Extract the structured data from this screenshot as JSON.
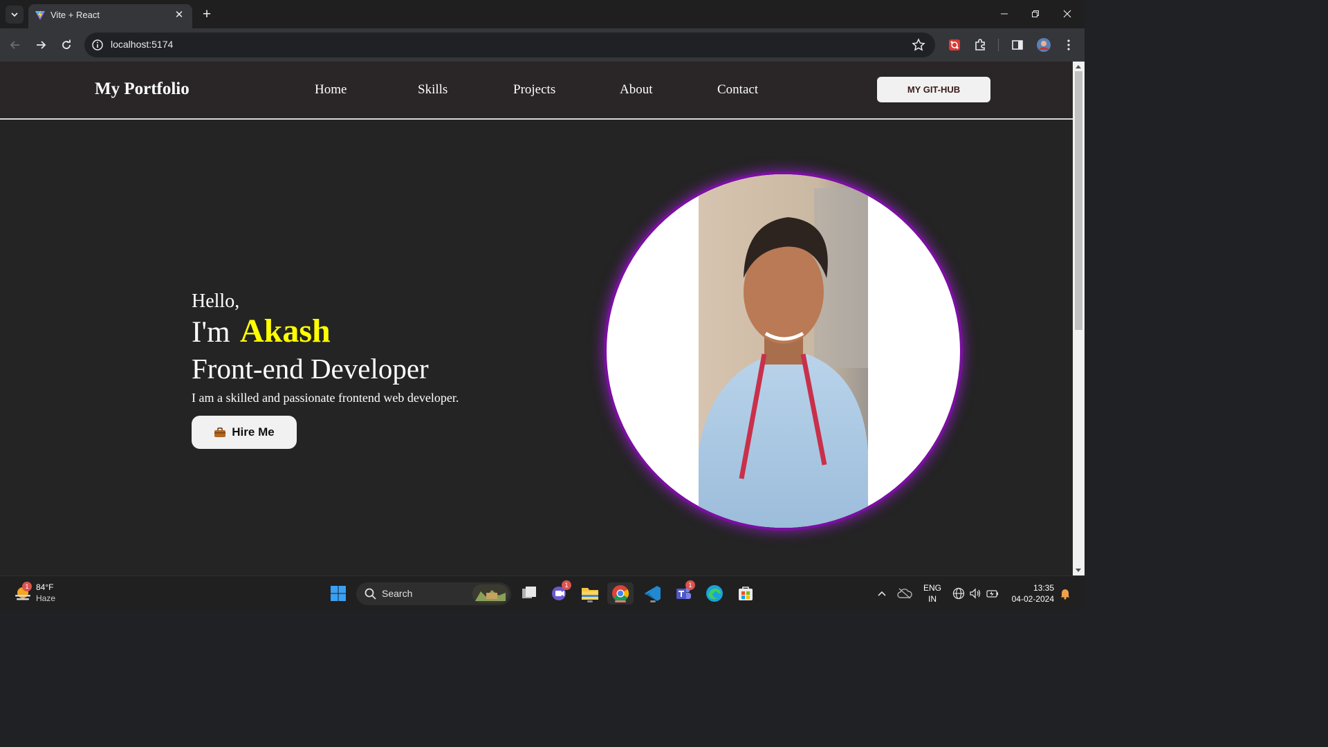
{
  "browser": {
    "tab": {
      "title": "Vite + React"
    },
    "address_bar": {
      "url": "localhost:5174"
    }
  },
  "site": {
    "brand": "My Portfolio",
    "nav": [
      "Home",
      "Skills",
      "Projects",
      "About",
      "Contact"
    ],
    "github_button": "MY GIT-HUB"
  },
  "hero": {
    "greeting": "Hello,",
    "intro": "I'm",
    "name": "Akash",
    "role": "Front-end Developer",
    "description": "I am a skilled and passionate frontend web developer.",
    "cta": "Hire Me",
    "accent_color": "#ffff00",
    "glow_color": "#7a0fa0"
  },
  "taskbar": {
    "weather": {
      "temperature": "84°F",
      "condition": "Haze",
      "badge": "1"
    },
    "search_placeholder": "Search",
    "meet_badge": "1",
    "teams_badge": "1",
    "language": {
      "line1": "ENG",
      "line2": "IN"
    },
    "clock": {
      "time": "13:35",
      "date": "04-02-2024"
    }
  }
}
